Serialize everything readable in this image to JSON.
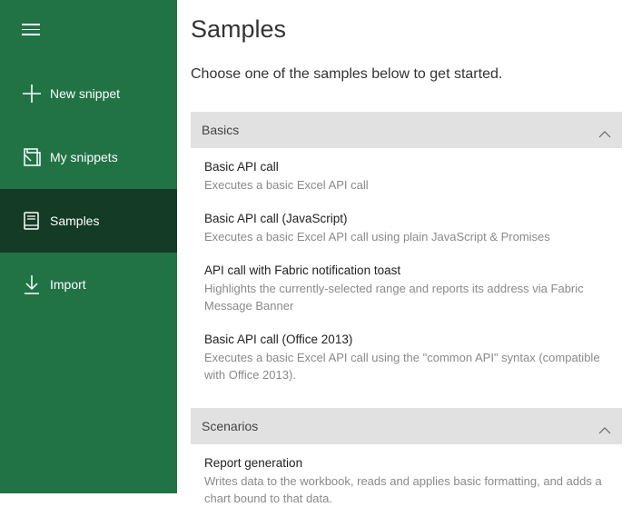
{
  "sidebar": {
    "menu_icon": "hamburger-icon",
    "items": [
      {
        "label": "New snippet",
        "icon": "plus-icon"
      },
      {
        "label": "My snippets",
        "icon": "snippets-icon"
      },
      {
        "label": "Samples",
        "icon": "book-icon",
        "active": true
      },
      {
        "label": "Import",
        "icon": "download-icon"
      }
    ],
    "colors": {
      "background": "#217346",
      "active": "#133b25"
    }
  },
  "main": {
    "title": "Samples",
    "subtitle": "Choose one of the samples below to get started.",
    "groups": [
      {
        "title": "Basics",
        "expanded": true,
        "samples": [
          {
            "title": "Basic API call",
            "description": "Executes a basic Excel API call"
          },
          {
            "title": "Basic API call (JavaScript)",
            "description": "Executes a basic Excel API call using plain JavaScript & Promises"
          },
          {
            "title": "API call with Fabric notification toast",
            "description": "Highlights the currently-selected range and reports its address via Fabric Message Banner"
          },
          {
            "title": "Basic API call (Office 2013)",
            "description": "Executes a basic Excel API call using the \"common API\" syntax (compatible with Office 2013)."
          }
        ]
      },
      {
        "title": "Scenarios",
        "expanded": true,
        "samples": [
          {
            "title": "Report generation",
            "description": "Writes data to the workbook, reads and applies basic formatting, and adds a chart bound to that data."
          }
        ]
      }
    ]
  }
}
